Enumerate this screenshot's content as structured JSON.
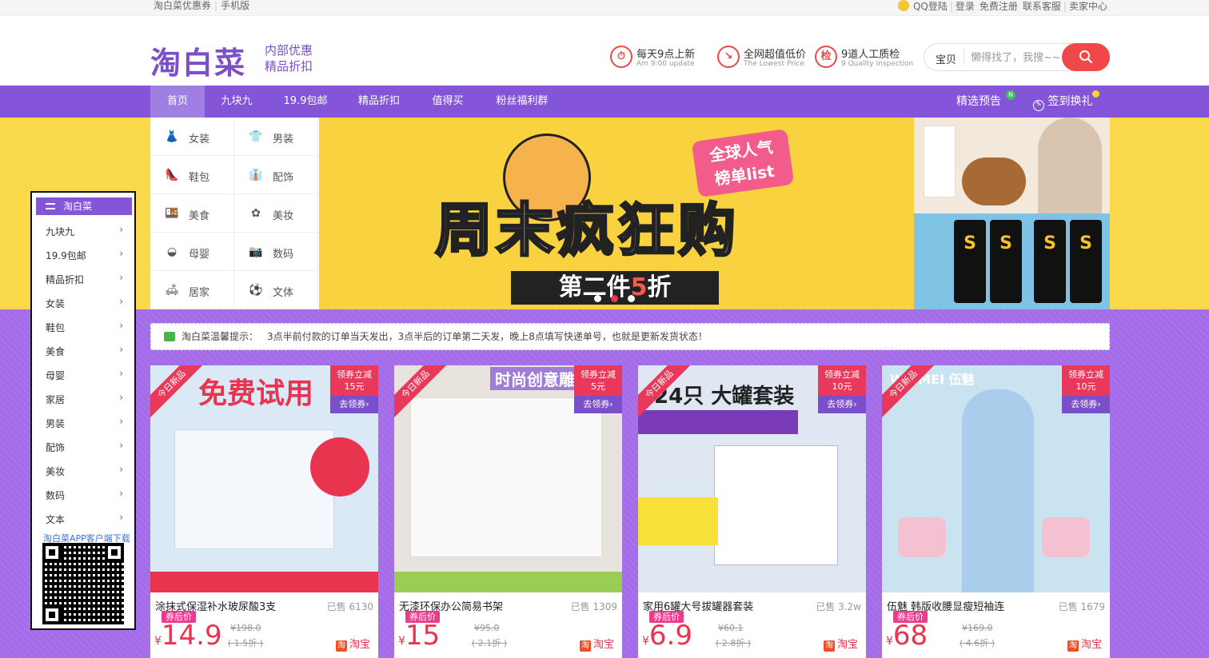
{
  "topbar": {
    "left": [
      "淘白菜优惠券",
      "手机版"
    ],
    "right": [
      "QQ登陆",
      "登录",
      "免费注册",
      "联系客服",
      "卖家中心"
    ]
  },
  "header": {
    "logo": "淘白菜",
    "slogan": [
      "内部优惠",
      "精品折扣"
    ],
    "features": [
      {
        "icon": "clock-icon",
        "glyph": "⏱",
        "title": "每天9点上新",
        "sub": "Am 9:00 update"
      },
      {
        "icon": "price-down-icon",
        "glyph": "↘",
        "title": "全网超值低价",
        "sub": "The Lowest Price"
      },
      {
        "icon": "inspect-icon",
        "glyph": "检",
        "title": "9道人工质检",
        "sub": "9 Quality Inspection"
      }
    ],
    "search": {
      "category": "宝贝",
      "placeholder": "懒得找了，我搜~~",
      "button_icon": "search-icon"
    }
  },
  "nav": {
    "items": [
      "首页",
      "九块九",
      "19.9包邮",
      "精品折扣",
      "值得买",
      "粉丝福利群"
    ],
    "active": 0,
    "right": [
      {
        "label": "精选预告",
        "badge": "N"
      },
      {
        "label": "签到换礼",
        "icon": "edit-circle-icon"
      }
    ]
  },
  "categories": [
    {
      "label": "女装",
      "icon": "dress-icon",
      "glyph": "👗"
    },
    {
      "label": "男装",
      "icon": "tshirt-icon",
      "glyph": "👕"
    },
    {
      "label": "鞋包",
      "icon": "heel-icon",
      "glyph": "👠"
    },
    {
      "label": "配饰",
      "icon": "tie-icon",
      "glyph": "👔"
    },
    {
      "label": "美食",
      "icon": "food-icon",
      "glyph": "🍱"
    },
    {
      "label": "美妆",
      "icon": "flower-icon",
      "glyph": "✿"
    },
    {
      "label": "母婴",
      "icon": "baby-icon",
      "glyph": "◒"
    },
    {
      "label": "数码",
      "icon": "camera-icon",
      "glyph": "📷"
    },
    {
      "label": "居家",
      "icon": "sofa-icon",
      "glyph": "🛋"
    },
    {
      "label": "文体",
      "icon": "sport-icon",
      "glyph": "⚽"
    }
  ],
  "banner": {
    "tag": "全球人气\n榜单list",
    "title": "周末疯狂购",
    "sub_prefix": "第二件",
    "sub_number": "5",
    "sub_suffix": "折"
  },
  "notice": {
    "label": "淘白菜温馨提示：",
    "text": "3点半前付款的订单当天发出，3点半后的订单第二天发，晚上8点填写快递单号，也就是更新发货状态！"
  },
  "products": [
    {
      "ribbon": "今日新品",
      "coupon_label": "领券立减",
      "coupon": "15元",
      "coupon_btn": "去领券",
      "title": "涂抹式保湿补水玻尿酸3支",
      "sold": "已售 6130",
      "after_label": "券后价",
      "price": "14.9",
      "orig": "¥198.0",
      "discount": "( 1.5折 )",
      "shop": "淘宝",
      "img_color": "#dbe9f7",
      "img_text": "免费试用"
    },
    {
      "ribbon": "今日新品",
      "coupon_label": "领券立减",
      "coupon": "5元",
      "coupon_btn": "去领券",
      "title": "无漆环保办公简易书架",
      "sold": "已售 1309",
      "after_label": "券后价",
      "price": "15",
      "orig": "¥95.0",
      "discount": "( 2.1折 )",
      "shop": "淘宝",
      "img_color": "#e8e4dd",
      "img_text": "时尚创意雕"
    },
    {
      "ribbon": "今日新品",
      "coupon_label": "领券立减",
      "coupon": "10元",
      "coupon_btn": "去领券",
      "title": "家用6罐大号拔罐器套装",
      "sold": "已售 3.2w",
      "after_label": "券后价",
      "price": "6.9",
      "orig": "¥60.1",
      "discount": "( 2.8折 )",
      "shop": "淘宝",
      "img_color": "#dfe8f2",
      "img_text": "24只 大罐套装"
    },
    {
      "ribbon": "今日新品",
      "coupon_label": "领券立减",
      "coupon": "10元",
      "coupon_btn": "去领券",
      "title": "伍魅 韩版收腰显瘦短袖连",
      "sold": "已售 1679",
      "after_label": "券后价",
      "price": "68",
      "orig": "¥169.0",
      "discount": "( 4.6折 )",
      "shop": "淘宝",
      "img_color": "#c9e3f0",
      "img_text": "WAIMEI 伍魅"
    }
  ],
  "left_nav": {
    "header": "淘白菜",
    "items": [
      "九块九",
      "19.9包邮",
      "精品折扣",
      "女装",
      "鞋包",
      "美食",
      "母婴",
      "家居",
      "男装",
      "配饰",
      "美妆",
      "数码",
      "文本"
    ],
    "app_text": "淘白菜APP客户端下载"
  },
  "colors": {
    "brand_purple": "#8454d9",
    "accent_red": "#e8344e",
    "banner_yellow": "#f9d84a"
  }
}
